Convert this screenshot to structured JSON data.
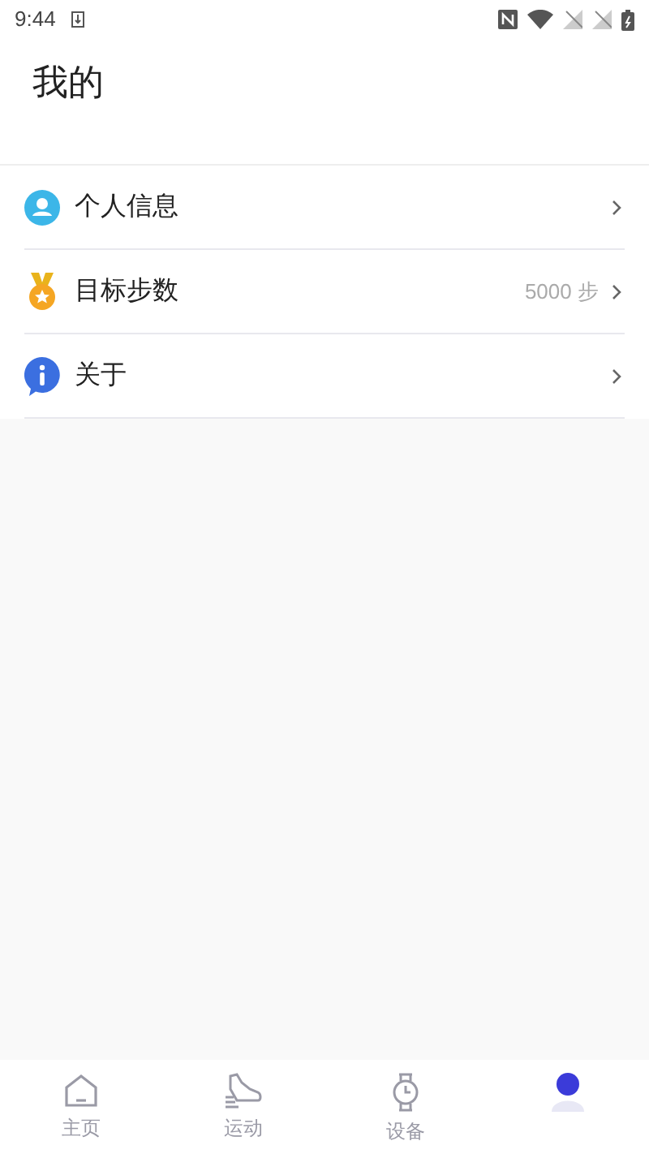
{
  "status_bar": {
    "time": "9:44"
  },
  "header": {
    "title": "我的"
  },
  "menu": [
    {
      "kind": "profile",
      "label": "个人信息"
    },
    {
      "kind": "goal",
      "label": "目标步数",
      "value": "5000 步"
    },
    {
      "kind": "about",
      "label": "关于"
    }
  ],
  "tab_bar": [
    {
      "kind": "home",
      "label": "主页",
      "selected": false
    },
    {
      "kind": "sport",
      "label": "运动",
      "selected": false
    },
    {
      "kind": "device",
      "label": "设备",
      "selected": false
    },
    {
      "kind": "me",
      "selected": true
    }
  ]
}
